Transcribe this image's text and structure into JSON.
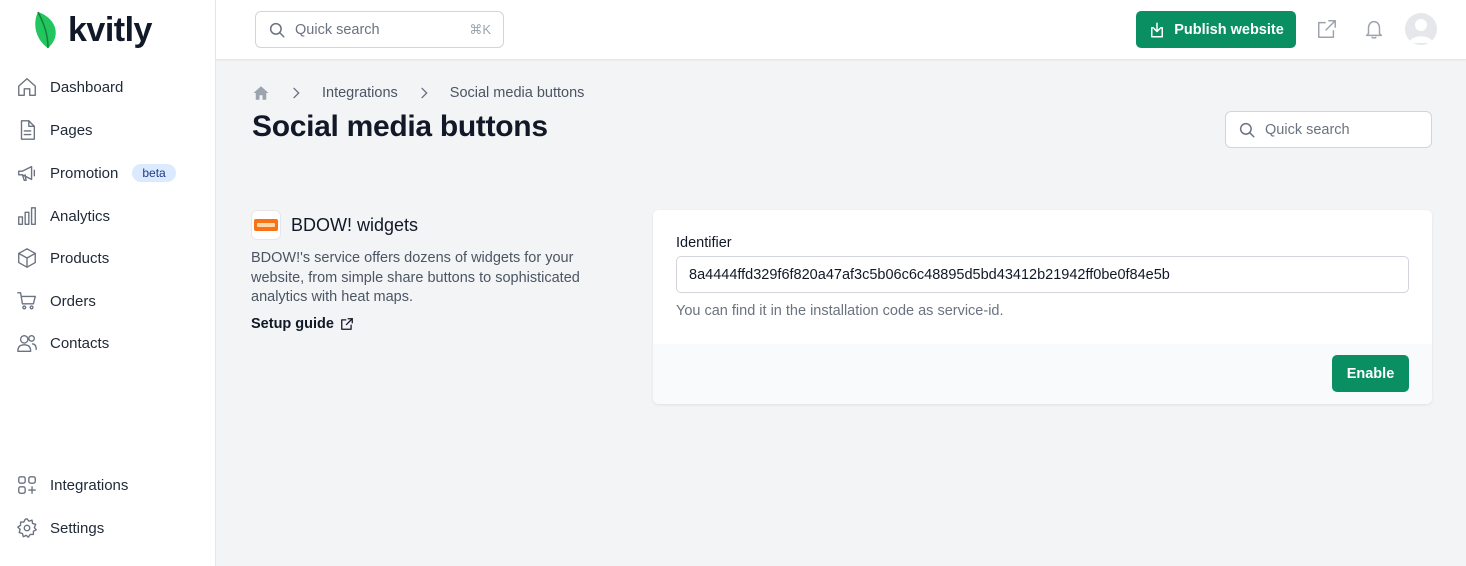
{
  "app": {
    "logo_text": "kvitly",
    "brand_color": "#0a8f62"
  },
  "sidebar": {
    "items": [
      {
        "label": "Dashboard",
        "icon": "home-icon"
      },
      {
        "label": "Pages",
        "icon": "document-icon"
      },
      {
        "label": "Promotion",
        "icon": "megaphone-icon",
        "badge": "beta"
      },
      {
        "label": "Analytics",
        "icon": "bar-chart-icon"
      },
      {
        "label": "Products",
        "icon": "cube-icon"
      },
      {
        "label": "Orders",
        "icon": "cart-icon"
      },
      {
        "label": "Contacts",
        "icon": "users-icon"
      }
    ],
    "bottom_items": [
      {
        "label": "Integrations",
        "icon": "puzzle-grid-icon"
      },
      {
        "label": "Settings",
        "icon": "gear-icon"
      }
    ]
  },
  "topbar": {
    "search_placeholder": "Quick search",
    "search_shortcut": "⌘K",
    "publish_label": "Publish website"
  },
  "breadcrumb": {
    "items": [
      "Integrations",
      "Social media buttons"
    ]
  },
  "page": {
    "title": "Social media buttons",
    "search_placeholder": "Quick search"
  },
  "widget": {
    "name": "BDOW! widgets",
    "description": "BDOW!'s service offers dozens of widgets for your website, from simple share buttons to sophisticated analytics with heat maps.",
    "setup_link": "Setup guide"
  },
  "form": {
    "identifier_label": "Identifier",
    "identifier_value": "8a4444ffd329f6f820a47af3c5b06c6c48895d5bd43412b21942ff0be0f84e5b",
    "hint": "You can find it in the installation code as service-id.",
    "enable_label": "Enable"
  }
}
